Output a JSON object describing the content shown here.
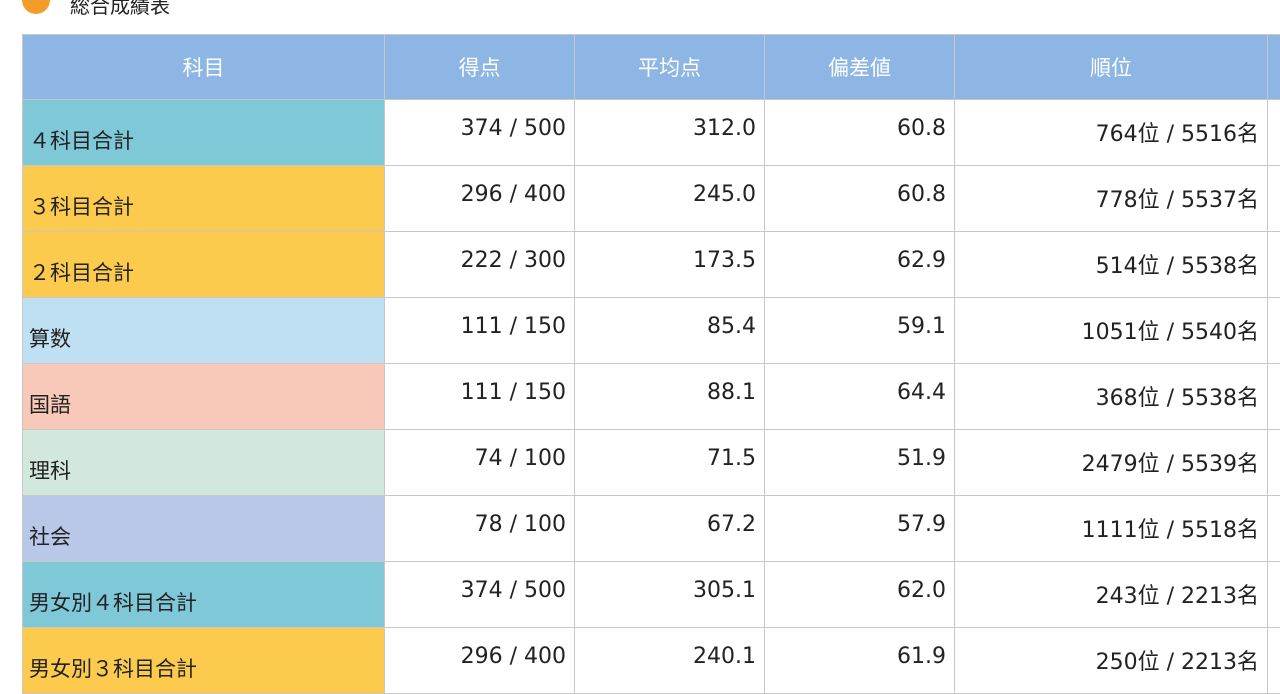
{
  "section": {
    "title": "総合成績表",
    "dot_color": "#f39c2a"
  },
  "colors": {
    "header": "#8db6e4",
    "teal": "#7ec8d8",
    "yellow": "#fccb4e",
    "lightblue": "#bfdff2",
    "pink": "#f8c8b8",
    "green": "#d2e8dc",
    "lavender": "#b9c7e8"
  },
  "table": {
    "headers": [
      "科目",
      "得点",
      "平均点",
      "偏差値",
      "順位"
    ],
    "rows": [
      {
        "subject": "４科目合計",
        "score": "374 / 500",
        "average": "312.0",
        "deviation": "60.8",
        "rank": "764位 / 5516名",
        "color": "#7ec8d8"
      },
      {
        "subject": "３科目合計",
        "score": "296 / 400",
        "average": "245.0",
        "deviation": "60.8",
        "rank": "778位 / 5537名",
        "color": "#fccb4e"
      },
      {
        "subject": "２科目合計",
        "score": "222 / 300",
        "average": "173.5",
        "deviation": "62.9",
        "rank": "514位 / 5538名",
        "color": "#fccb4e"
      },
      {
        "subject": "算数",
        "score": "111 / 150",
        "average": "85.4",
        "deviation": "59.1",
        "rank": "1051位 / 5540名",
        "color": "#bfdff2"
      },
      {
        "subject": "国語",
        "score": "111 / 150",
        "average": "88.1",
        "deviation": "64.4",
        "rank": "368位 / 5538名",
        "color": "#f8c8b8"
      },
      {
        "subject": "理科",
        "score": "74 / 100",
        "average": "71.5",
        "deviation": "51.9",
        "rank": "2479位 / 5539名",
        "color": "#d2e8dc"
      },
      {
        "subject": "社会",
        "score": "78 / 100",
        "average": "67.2",
        "deviation": "57.9",
        "rank": "1111位 / 5518名",
        "color": "#b9c7e8"
      },
      {
        "subject": "男女別４科目合計",
        "score": "374 / 500",
        "average": "305.1",
        "deviation": "62.0",
        "rank": "243位 / 2213名",
        "color": "#7ec8d8"
      },
      {
        "subject": "男女別３科目合計",
        "score": "296 / 400",
        "average": "240.1",
        "deviation": "61.9",
        "rank": "250位 / 2213名",
        "color": "#fccb4e"
      }
    ]
  }
}
